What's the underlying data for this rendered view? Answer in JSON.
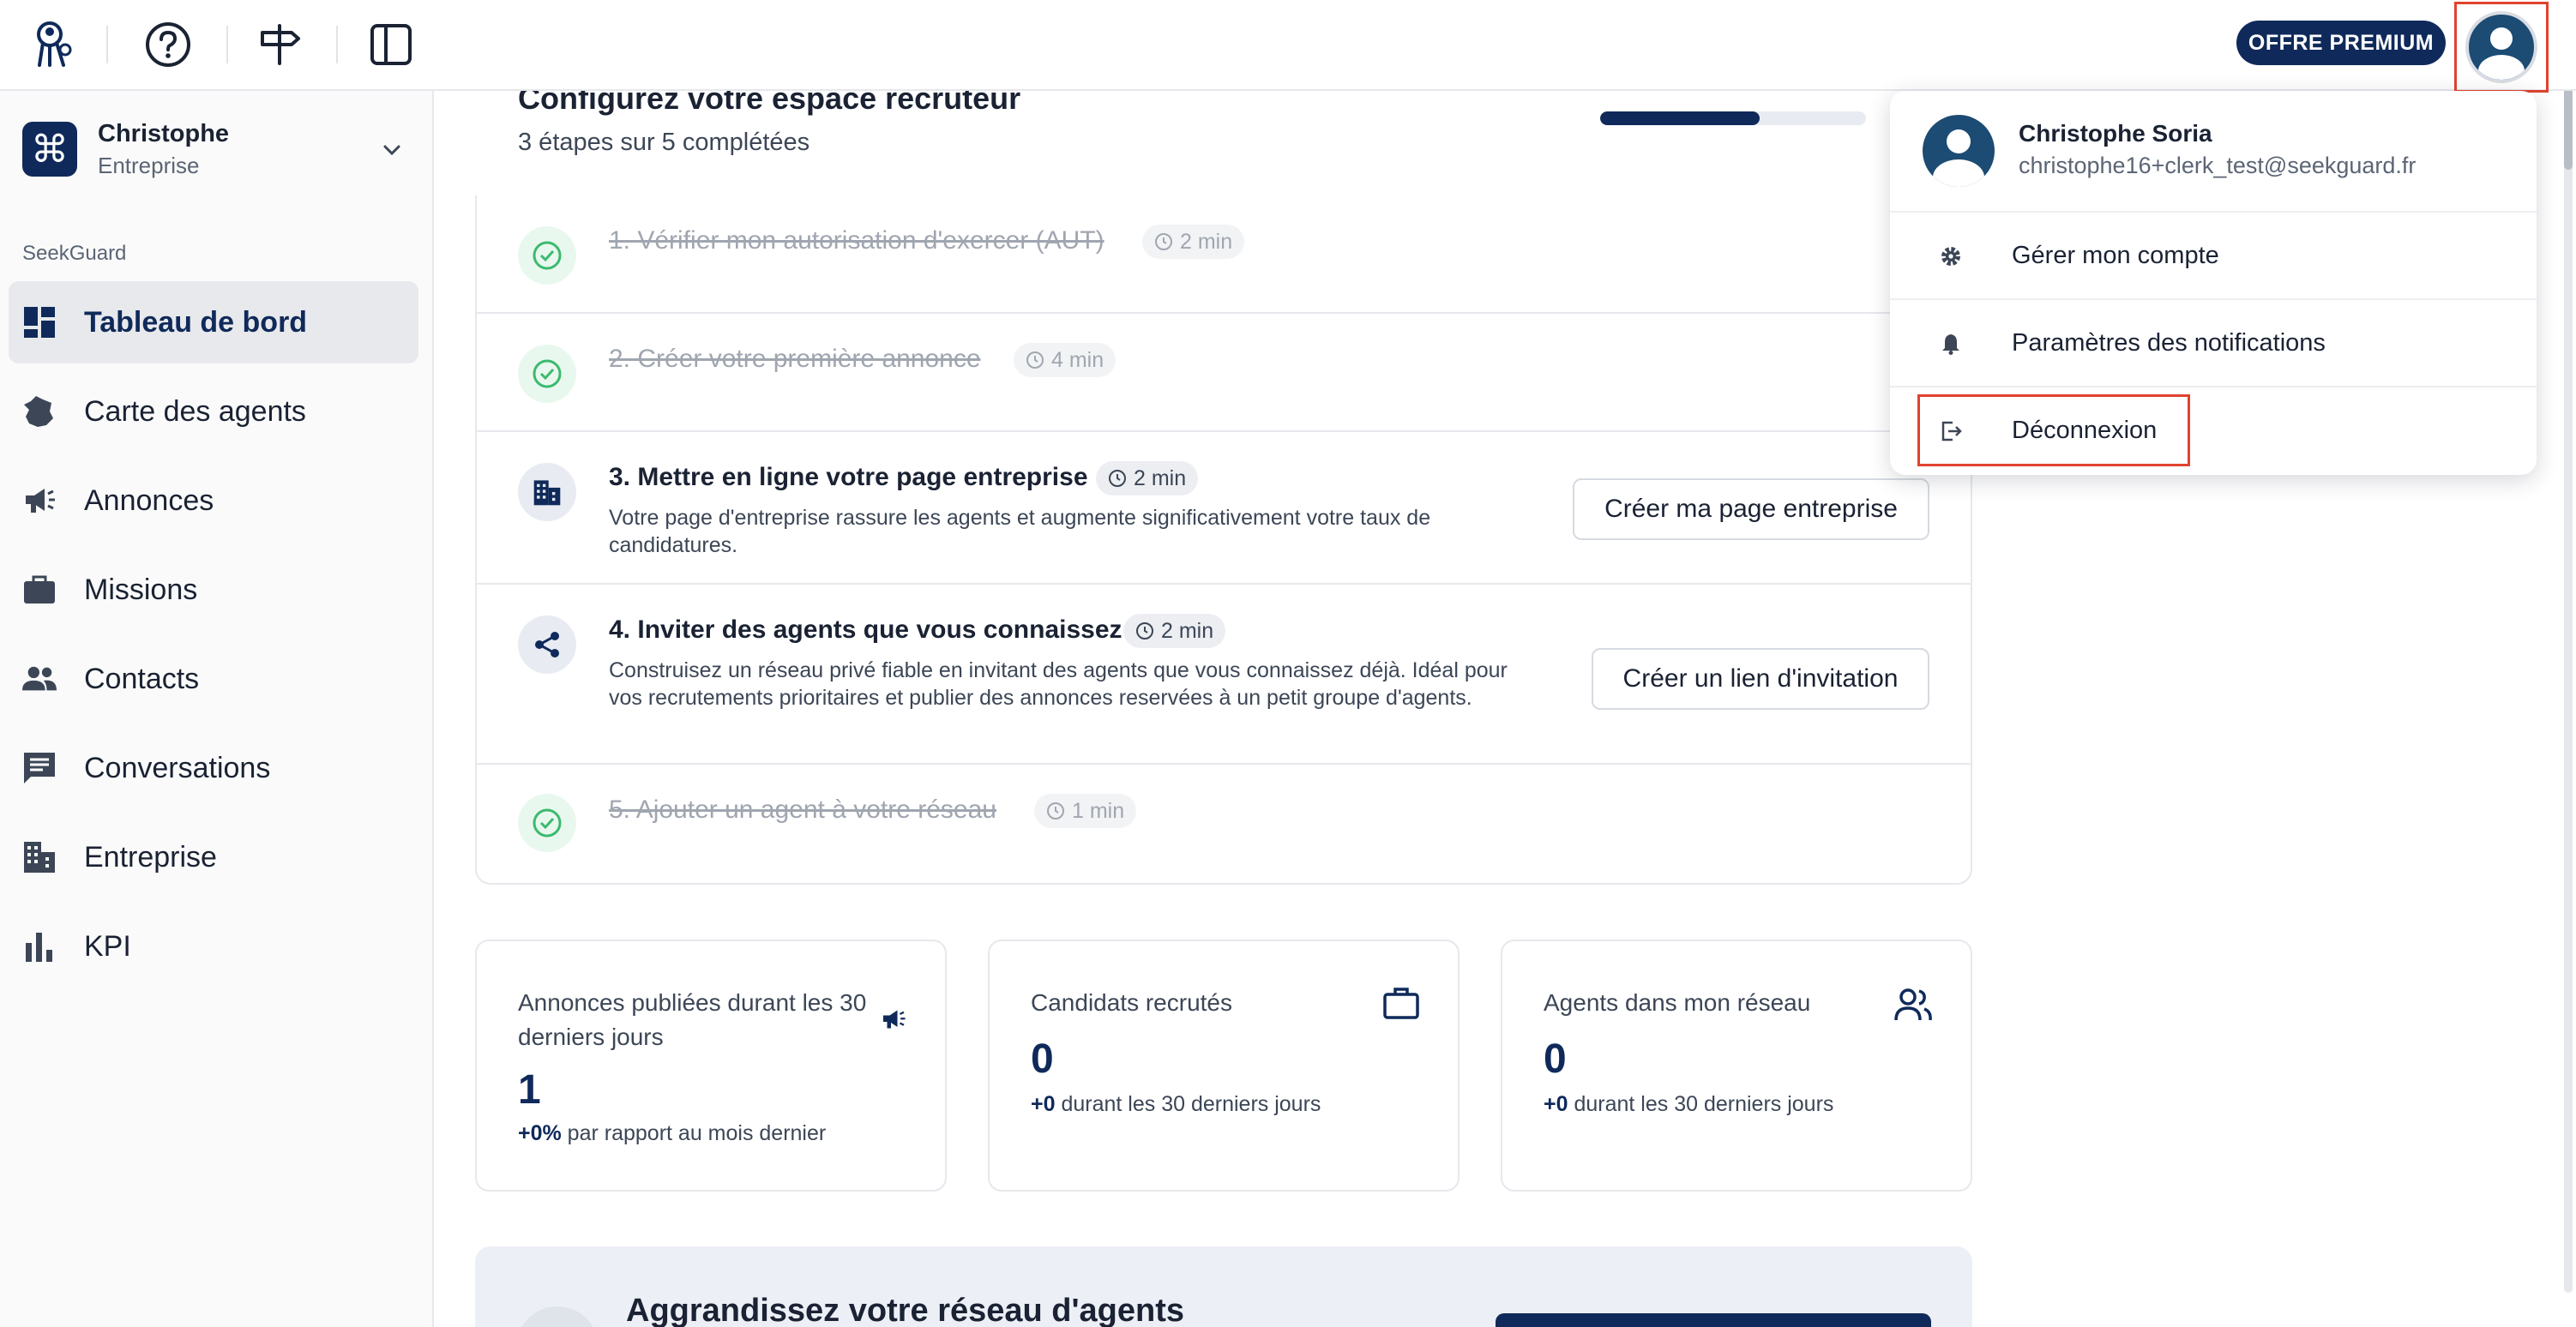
{
  "topbar": {
    "premium_label": "OFFRE PREMIUM",
    "icons": [
      "agent-logo-icon",
      "help-icon",
      "signpost-icon",
      "sidebar-toggle-icon"
    ]
  },
  "sidebar": {
    "org_name": "Christophe",
    "org_type": "Entreprise",
    "section_label": "SeekGuard",
    "items": [
      {
        "label": "Tableau de bord",
        "icon": "dashboard-icon",
        "active": true
      },
      {
        "label": "Carte des agents",
        "icon": "france-map-icon"
      },
      {
        "label": "Annonces",
        "icon": "megaphone-icon"
      },
      {
        "label": "Missions",
        "icon": "briefcase-icon"
      },
      {
        "label": "Contacts",
        "icon": "people-icon"
      },
      {
        "label": "Conversations",
        "icon": "chat-icon"
      },
      {
        "label": "Entreprise",
        "icon": "building-icon"
      },
      {
        "label": "KPI",
        "icon": "bar-chart-icon"
      }
    ]
  },
  "onboarding": {
    "title": "Configurez votre espace recruteur",
    "subtitle": "3 étapes sur 5 complétées",
    "progress": 0.6,
    "steps": [
      {
        "title": "1. Vérifier mon autorisation d'exercer (AUT)",
        "duration": "2 min",
        "done": true
      },
      {
        "title": "2. Créer votre première annonce",
        "duration": "4 min",
        "done": true
      },
      {
        "title": "3. Mettre en ligne votre page entreprise",
        "duration": "2 min",
        "done": false,
        "desc": "Votre page d'entreprise rassure les agents et augmente significativement votre taux de candidatures.",
        "button": "Créer ma page entreprise"
      },
      {
        "title": "4. Inviter des agents que vous connaissez",
        "duration": "2 min",
        "done": false,
        "desc": "Construisez un réseau privé fiable en invitant des agents que vous connaissez déjà. Idéal pour vos recrutements prioritaires et publier des annonces reservées à un petit groupe d'agents.",
        "button": "Créer un lien d'invitation"
      },
      {
        "title": "5. Ajouter un agent à votre réseau",
        "duration": "1 min",
        "done": true
      }
    ]
  },
  "stats": [
    {
      "title": "Annonces publiées durant les 30 derniers jours",
      "value": "1",
      "delta": "+0%",
      "note": " par rapport au mois dernier",
      "icon": "megaphone-icon"
    },
    {
      "title": "Candidats recrutés",
      "value": "0",
      "delta": "+0",
      "note": " durant les 30 derniers jours",
      "icon": "briefcase-icon"
    },
    {
      "title": "Agents dans mon réseau",
      "value": "0",
      "delta": "+0",
      "note": " durant les 30 derniers jours",
      "icon": "people-icon"
    }
  ],
  "grow": {
    "title": "Aggrandissez votre réseau d'agents"
  },
  "user_menu": {
    "name": "Christophe Soria",
    "email": "christophe16+clerk_test@seekguard.fr",
    "items": [
      {
        "label": "Gérer mon compte",
        "icon": "gear-icon"
      },
      {
        "label": "Paramètres des notifications",
        "icon": "bell-icon"
      },
      {
        "label": "Déconnexion",
        "icon": "logout-icon"
      }
    ]
  },
  "colors": {
    "brand": "#0f2a5a",
    "success": "#3cba6f",
    "highlight": "#e0432f"
  }
}
